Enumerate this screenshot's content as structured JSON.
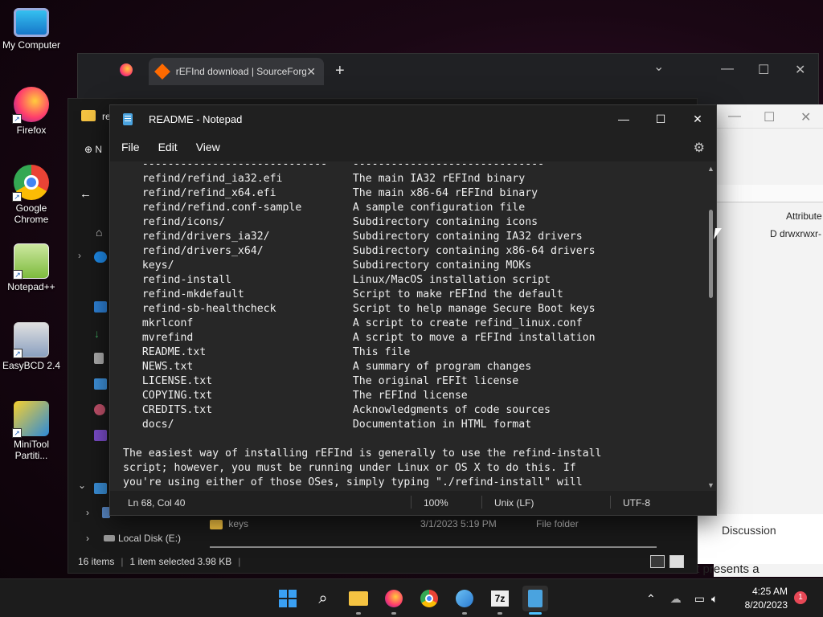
{
  "desktop": {
    "icons": [
      {
        "label": "My Computer"
      },
      {
        "label": "Firefox"
      },
      {
        "label": "Google Chrome"
      },
      {
        "label": "Notepad++"
      },
      {
        "label": "EasyBCD 2.4"
      },
      {
        "label": "MiniTool Partiti..."
      }
    ]
  },
  "browser": {
    "tab_title": "rEFInd download | SourceForge",
    "new_tab": "+",
    "dropdown": "⌄",
    "minimize": "—",
    "maximize": "☐",
    "close": "✕"
  },
  "explorer": {
    "title_partial": "re",
    "new_partial": "N",
    "local_disk": "Local Disk (E:)",
    "row": {
      "name": "keys",
      "date": "3/1/2023 5:19 PM",
      "type": "File folder"
    },
    "status_items": "16 items",
    "status_selected": "1 item selected  3.98 KB"
  },
  "right_window": {
    "attributes_header": "Attribute",
    "attributes_value": "D drwxrwxr-",
    "discussion": "Discussion",
    "tail_text": "nd it presents a"
  },
  "notepad": {
    "title": "README - Notepad",
    "menu": {
      "file": "File",
      "edit": "Edit",
      "view": "View"
    },
    "text_lines": [
      "   -----------------------------    ------------------------------",
      "   refind/refind_ia32.efi           The main IA32 rEFInd binary",
      "   refind/refind_x64.efi            The main x86-64 rEFInd binary",
      "   refind/refind.conf-sample        A sample configuration file",
      "   refind/icons/                    Subdirectory containing icons",
      "   refind/drivers_ia32/             Subdirectory containing IA32 drivers",
      "   refind/drivers_x64/              Subdirectory containing x86-64 drivers",
      "   keys/                            Subdirectory containing MOKs",
      "   refind-install                   Linux/MacOS installation script",
      "   refind-mkdefault                 Script to make rEFInd the default",
      "   refind-sb-healthcheck            Script to help manage Secure Boot keys",
      "   mkrlconf                         A script to create refind_linux.conf",
      "   mvrefind                         A script to move a rEFInd installation",
      "   README.txt                       This file",
      "   NEWS.txt                         A summary of program changes",
      "   LICENSE.txt                      The original rEFIt license",
      "   COPYING.txt                      The rEFInd license",
      "   CREDITS.txt                      Acknowledgments of code sources",
      "   docs/                            Documentation in HTML format",
      "",
      "The easiest way of installing rEFInd is generally to use the refind-install",
      "script; however, you must be running under Linux or OS X to do this. If",
      "you're using either of those OSes, simply typing \"./refind-install\" will"
    ],
    "status": {
      "position": "Ln 68, Col 40",
      "zoom": "100%",
      "line_ending": "Unix (LF)",
      "encoding": "UTF-8"
    }
  },
  "taskbar": {
    "clock_time": "4:25 AM",
    "clock_date": "8/20/2023",
    "notification_count": "1"
  },
  "colors": {
    "accent": "#4cc2ff",
    "notepad_bg": "#272727",
    "taskbar_bg": "#1c1c1c"
  }
}
